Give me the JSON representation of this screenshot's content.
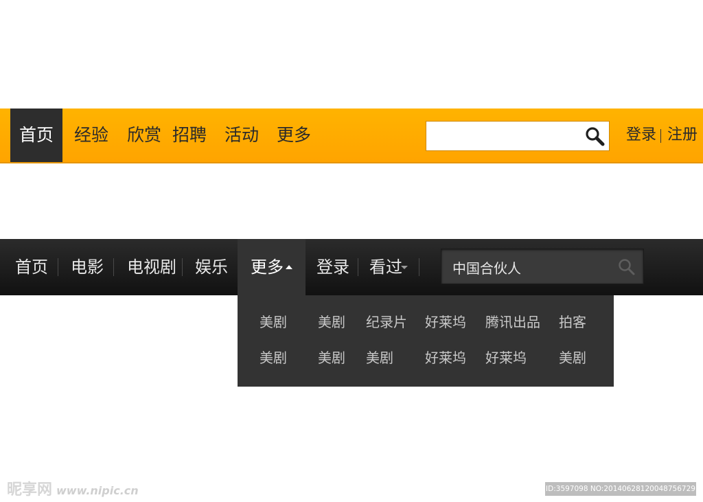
{
  "top_nav": {
    "items": [
      {
        "label": "首页",
        "active": true
      },
      {
        "label": "经验"
      },
      {
        "label": "欣赏"
      },
      {
        "label": "招聘"
      },
      {
        "label": "活动"
      },
      {
        "label": "更多"
      }
    ],
    "search": {
      "value": "",
      "placeholder": "",
      "icon": "search-icon"
    },
    "login_label": "登录",
    "register_label": "注册",
    "accent_color": "#ffa800",
    "active_color": "#2d2d2d"
  },
  "dark_nav": {
    "items": [
      {
        "label": "首页"
      },
      {
        "label": "电影"
      },
      {
        "label": "电视剧"
      },
      {
        "label": "娱乐"
      }
    ],
    "more_label": "更多",
    "login_label": "登录",
    "history_label": "看过",
    "search": {
      "value": "中国合伙人",
      "icon": "search-icon"
    },
    "dropdown": {
      "rows": [
        [
          "美剧",
          "美剧",
          "纪录片",
          "好莱坞",
          "腾讯出品",
          "拍客"
        ],
        [
          "美剧",
          "美剧",
          "美剧",
          "好莱坞",
          "好莱坞",
          "美剧"
        ]
      ]
    },
    "bar_color": "#1a1a1a",
    "dropdown_color": "#333333"
  },
  "watermark": {
    "logo": "昵享网",
    "site": "www.nipic.cn",
    "id_text": "ID:3597098 NO:20140628120048756729"
  }
}
